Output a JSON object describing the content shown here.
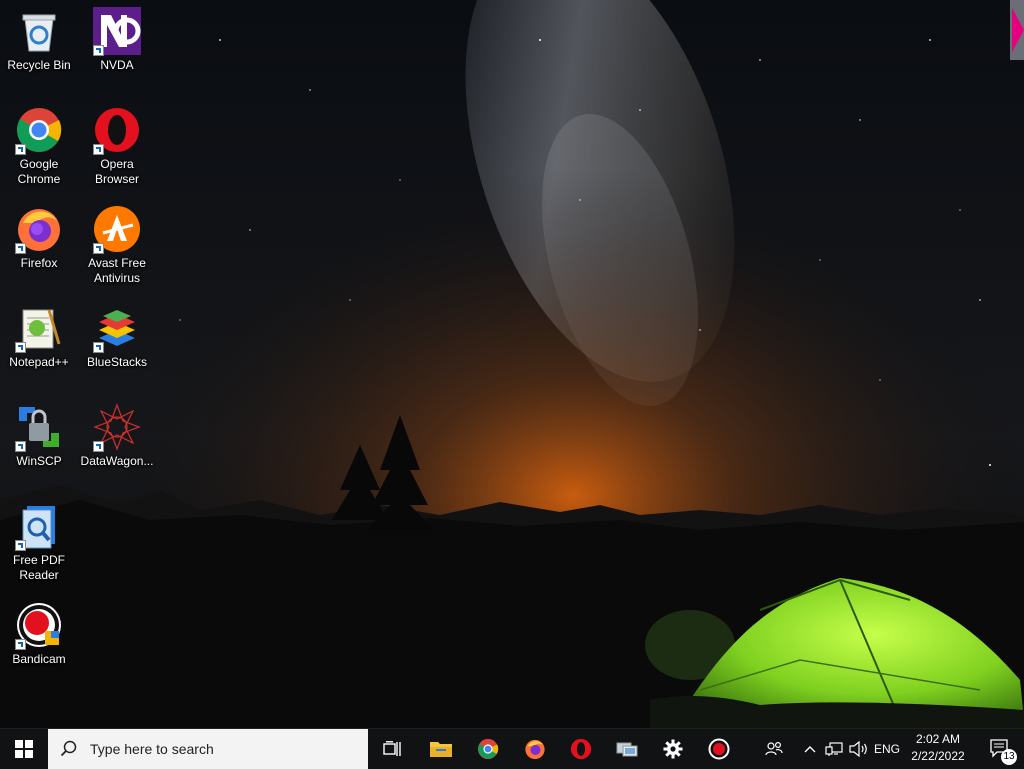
{
  "desktop": {
    "icons": [
      {
        "label": "Recycle Bin"
      },
      {
        "label": "NVDA"
      },
      {
        "label": "Google Chrome"
      },
      {
        "label": "Opera Browser"
      },
      {
        "label": "Firefox"
      },
      {
        "label": "Avast Free Antivirus"
      },
      {
        "label": "Notepad++"
      },
      {
        "label": "BlueStacks"
      },
      {
        "label": "WinSCP"
      },
      {
        "label": "DataWagon..."
      },
      {
        "label": "Free PDF Reader"
      },
      {
        "label": "Bandicam"
      }
    ]
  },
  "taskbar": {
    "search_placeholder": "Type here to search",
    "pinned": [
      {
        "icon": "task-view-icon"
      },
      {
        "icon": "file-explorer-icon"
      },
      {
        "icon": "chrome-icon"
      },
      {
        "icon": "firefox-icon"
      },
      {
        "icon": "opera-icon"
      },
      {
        "icon": "network-app-icon"
      },
      {
        "icon": "settings-gear-icon"
      },
      {
        "icon": "record-icon"
      }
    ],
    "tray": {
      "language": "ENG",
      "time": "2:02 AM",
      "date": "2/22/2022",
      "notification_count": "13"
    }
  },
  "colors": {
    "taskbar_bg": "#101214",
    "search_bg": "#f3f3f3",
    "accent_tent": "#7ed321",
    "edge_tab": "#e6007e"
  }
}
